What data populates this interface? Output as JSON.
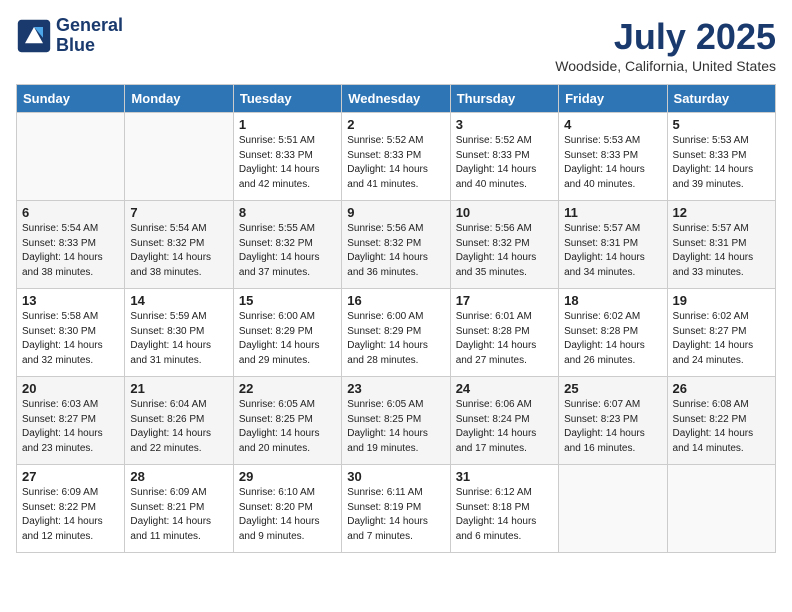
{
  "logo": {
    "line1": "General",
    "line2": "Blue"
  },
  "title": "July 2025",
  "location": "Woodside, California, United States",
  "days_of_week": [
    "Sunday",
    "Monday",
    "Tuesday",
    "Wednesday",
    "Thursday",
    "Friday",
    "Saturday"
  ],
  "weeks": [
    [
      {
        "day": "",
        "info": ""
      },
      {
        "day": "",
        "info": ""
      },
      {
        "day": "1",
        "info": "Sunrise: 5:51 AM\nSunset: 8:33 PM\nDaylight: 14 hours and 42 minutes."
      },
      {
        "day": "2",
        "info": "Sunrise: 5:52 AM\nSunset: 8:33 PM\nDaylight: 14 hours and 41 minutes."
      },
      {
        "day": "3",
        "info": "Sunrise: 5:52 AM\nSunset: 8:33 PM\nDaylight: 14 hours and 40 minutes."
      },
      {
        "day": "4",
        "info": "Sunrise: 5:53 AM\nSunset: 8:33 PM\nDaylight: 14 hours and 40 minutes."
      },
      {
        "day": "5",
        "info": "Sunrise: 5:53 AM\nSunset: 8:33 PM\nDaylight: 14 hours and 39 minutes."
      }
    ],
    [
      {
        "day": "6",
        "info": "Sunrise: 5:54 AM\nSunset: 8:33 PM\nDaylight: 14 hours and 38 minutes."
      },
      {
        "day": "7",
        "info": "Sunrise: 5:54 AM\nSunset: 8:32 PM\nDaylight: 14 hours and 38 minutes."
      },
      {
        "day": "8",
        "info": "Sunrise: 5:55 AM\nSunset: 8:32 PM\nDaylight: 14 hours and 37 minutes."
      },
      {
        "day": "9",
        "info": "Sunrise: 5:56 AM\nSunset: 8:32 PM\nDaylight: 14 hours and 36 minutes."
      },
      {
        "day": "10",
        "info": "Sunrise: 5:56 AM\nSunset: 8:32 PM\nDaylight: 14 hours and 35 minutes."
      },
      {
        "day": "11",
        "info": "Sunrise: 5:57 AM\nSunset: 8:31 PM\nDaylight: 14 hours and 34 minutes."
      },
      {
        "day": "12",
        "info": "Sunrise: 5:57 AM\nSunset: 8:31 PM\nDaylight: 14 hours and 33 minutes."
      }
    ],
    [
      {
        "day": "13",
        "info": "Sunrise: 5:58 AM\nSunset: 8:30 PM\nDaylight: 14 hours and 32 minutes."
      },
      {
        "day": "14",
        "info": "Sunrise: 5:59 AM\nSunset: 8:30 PM\nDaylight: 14 hours and 31 minutes."
      },
      {
        "day": "15",
        "info": "Sunrise: 6:00 AM\nSunset: 8:29 PM\nDaylight: 14 hours and 29 minutes."
      },
      {
        "day": "16",
        "info": "Sunrise: 6:00 AM\nSunset: 8:29 PM\nDaylight: 14 hours and 28 minutes."
      },
      {
        "day": "17",
        "info": "Sunrise: 6:01 AM\nSunset: 8:28 PM\nDaylight: 14 hours and 27 minutes."
      },
      {
        "day": "18",
        "info": "Sunrise: 6:02 AM\nSunset: 8:28 PM\nDaylight: 14 hours and 26 minutes."
      },
      {
        "day": "19",
        "info": "Sunrise: 6:02 AM\nSunset: 8:27 PM\nDaylight: 14 hours and 24 minutes."
      }
    ],
    [
      {
        "day": "20",
        "info": "Sunrise: 6:03 AM\nSunset: 8:27 PM\nDaylight: 14 hours and 23 minutes."
      },
      {
        "day": "21",
        "info": "Sunrise: 6:04 AM\nSunset: 8:26 PM\nDaylight: 14 hours and 22 minutes."
      },
      {
        "day": "22",
        "info": "Sunrise: 6:05 AM\nSunset: 8:25 PM\nDaylight: 14 hours and 20 minutes."
      },
      {
        "day": "23",
        "info": "Sunrise: 6:05 AM\nSunset: 8:25 PM\nDaylight: 14 hours and 19 minutes."
      },
      {
        "day": "24",
        "info": "Sunrise: 6:06 AM\nSunset: 8:24 PM\nDaylight: 14 hours and 17 minutes."
      },
      {
        "day": "25",
        "info": "Sunrise: 6:07 AM\nSunset: 8:23 PM\nDaylight: 14 hours and 16 minutes."
      },
      {
        "day": "26",
        "info": "Sunrise: 6:08 AM\nSunset: 8:22 PM\nDaylight: 14 hours and 14 minutes."
      }
    ],
    [
      {
        "day": "27",
        "info": "Sunrise: 6:09 AM\nSunset: 8:22 PM\nDaylight: 14 hours and 12 minutes."
      },
      {
        "day": "28",
        "info": "Sunrise: 6:09 AM\nSunset: 8:21 PM\nDaylight: 14 hours and 11 minutes."
      },
      {
        "day": "29",
        "info": "Sunrise: 6:10 AM\nSunset: 8:20 PM\nDaylight: 14 hours and 9 minutes."
      },
      {
        "day": "30",
        "info": "Sunrise: 6:11 AM\nSunset: 8:19 PM\nDaylight: 14 hours and 7 minutes."
      },
      {
        "day": "31",
        "info": "Sunrise: 6:12 AM\nSunset: 8:18 PM\nDaylight: 14 hours and 6 minutes."
      },
      {
        "day": "",
        "info": ""
      },
      {
        "day": "",
        "info": ""
      }
    ]
  ]
}
